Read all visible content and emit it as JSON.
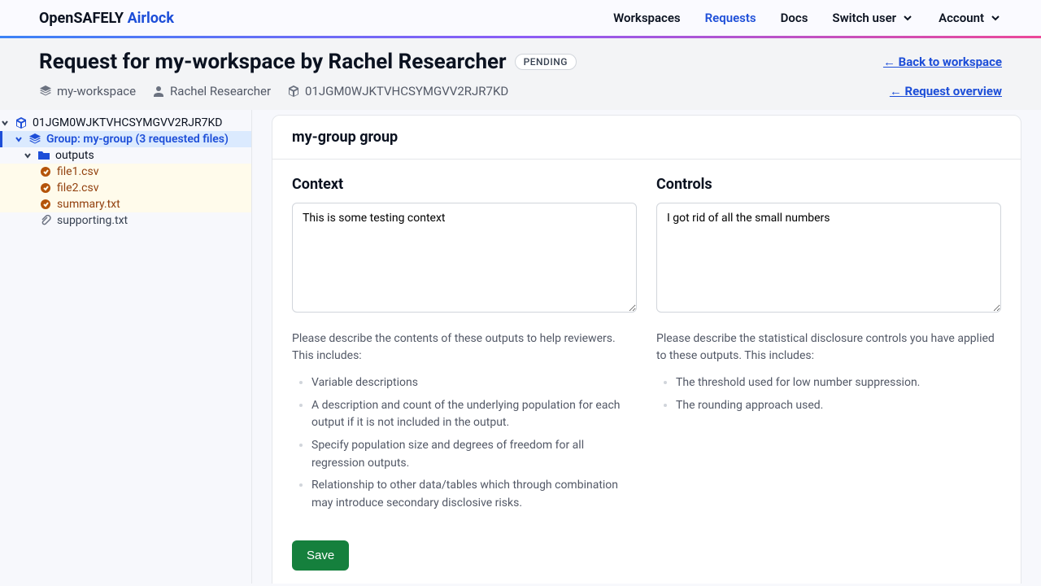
{
  "nav": {
    "logo_main": "OpenSAFELY",
    "logo_accent": "Airlock",
    "items": [
      {
        "label": "Workspaces"
      },
      {
        "label": "Requests",
        "active": true
      },
      {
        "label": "Docs"
      },
      {
        "label": "Switch user",
        "chevron": true
      },
      {
        "label": "Account",
        "chevron": true
      }
    ]
  },
  "header": {
    "title": "Request for my-workspace by Rachel Researcher",
    "status": "PENDING",
    "back_link": "← Back to workspace",
    "overview_link": "← Request overview",
    "workspace": "my-workspace",
    "user": "Rachel Researcher",
    "request_id": "01JGM0WJKTVHCSYMGVV2RJR7KD"
  },
  "tree": {
    "root": "01JGM0WJKTVHCSYMGVV2RJR7KD",
    "group": "Group: my-group (3 requested files)",
    "folder": "outputs",
    "files": [
      {
        "name": "file1.csv",
        "type": "output"
      },
      {
        "name": "file2.csv",
        "type": "output"
      },
      {
        "name": "summary.txt",
        "type": "output"
      },
      {
        "name": "supporting.txt",
        "type": "support"
      }
    ]
  },
  "group": {
    "title": "my-group group",
    "context": {
      "heading": "Context",
      "value": "This is some testing context",
      "help_intro": "Please describe the contents of these outputs to help reviewers. This includes:",
      "help_items": [
        "Variable descriptions",
        "A description and count of the underlying population for each output if it is not included in the output.",
        "Specify population size and degrees of freedom for all regression outputs.",
        "Relationship to other data/tables which through combination may introduce secondary disclosive risks."
      ]
    },
    "controls": {
      "heading": "Controls",
      "value": "I got rid of all the small numbers",
      "help_intro": "Please describe the statistical disclosure controls you have applied to these outputs. This includes:",
      "help_items": [
        "The threshold used for low number suppression.",
        "The rounding approach used."
      ]
    },
    "save_label": "Save"
  }
}
